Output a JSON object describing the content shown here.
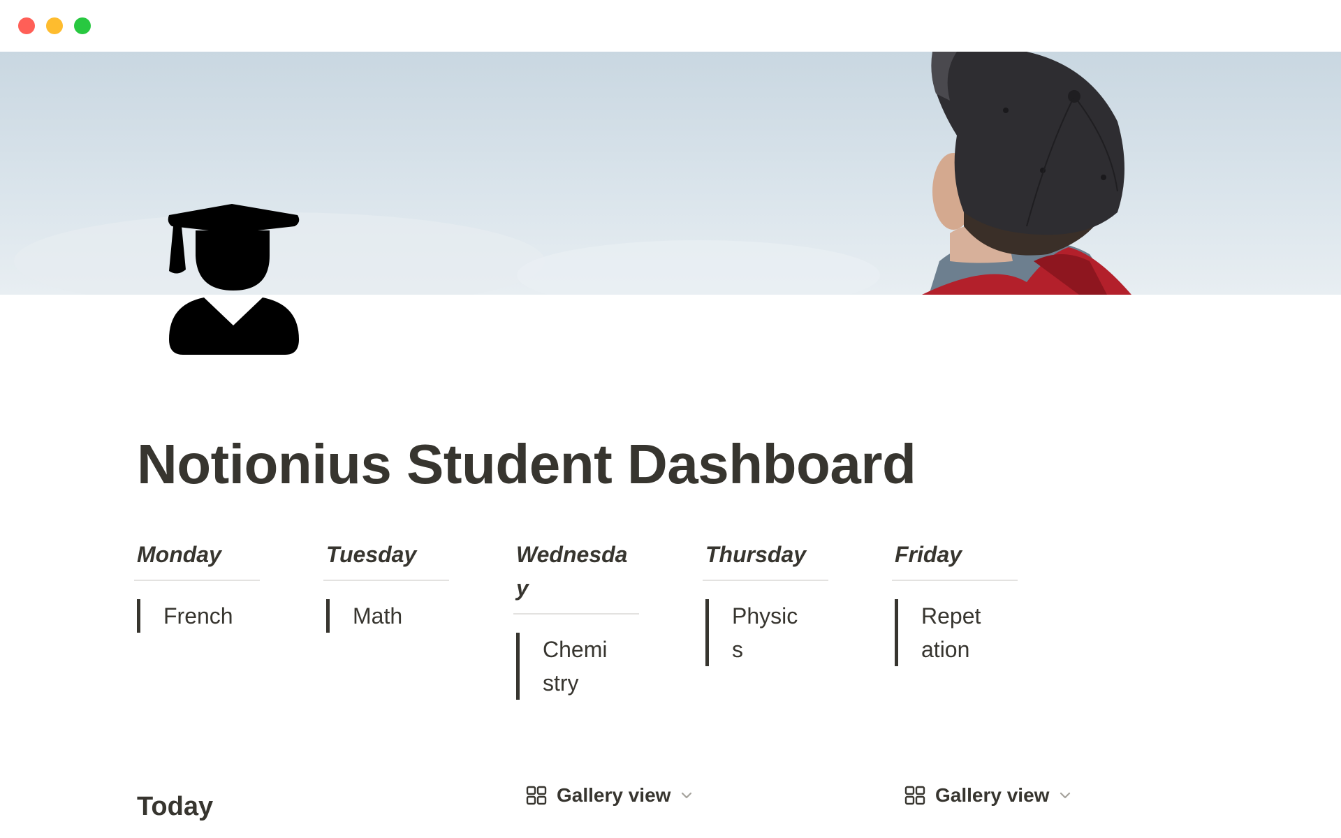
{
  "window": {
    "controls": [
      "close",
      "minimize",
      "zoom"
    ]
  },
  "page": {
    "icon": "graduate-student-icon",
    "title": "Notionius Student Dashboard"
  },
  "schedule": [
    {
      "day": "Monday",
      "subject": "French"
    },
    {
      "day": "Tuesday",
      "subject": "Math"
    },
    {
      "day": "Wednesday",
      "subject": "Chemistry"
    },
    {
      "day": "Thursday",
      "subject": "Physics"
    },
    {
      "day": "Friday",
      "subject": "Repetation"
    }
  ],
  "sections": {
    "today_heading": "Today",
    "views": [
      {
        "label": "Gallery view",
        "icon": "gallery-grid-icon"
      },
      {
        "label": "Gallery view",
        "icon": "gallery-grid-icon"
      }
    ]
  },
  "colors": {
    "text": "#37352f",
    "divider": "#e3e2e0",
    "close": "#ff5f57",
    "minimize": "#febc2e",
    "zoom": "#28c840"
  }
}
